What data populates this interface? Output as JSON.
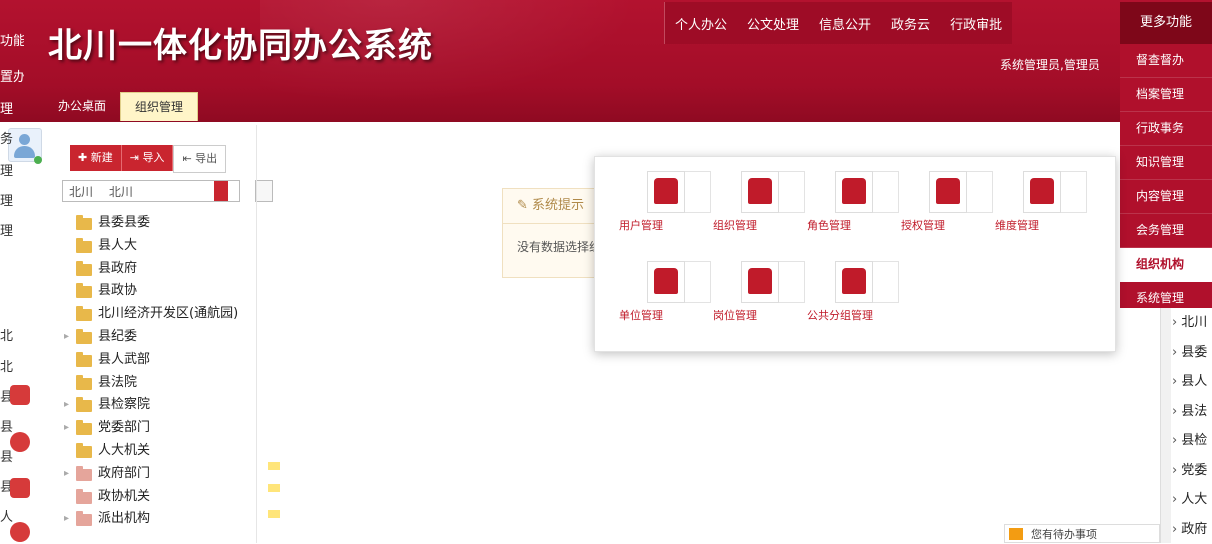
{
  "app": {
    "title": "北川一体化协同办公系统"
  },
  "top_nav": [
    "个人办公",
    "公文处理",
    "信息公开",
    "政务云",
    "行政审批"
  ],
  "more_label": "更多功能",
  "sub_nav": "系统管理员,管理员",
  "tabs": [
    {
      "label": "办公桌面"
    },
    {
      "label": "组织管理"
    }
  ],
  "left_column": {
    "items": [
      "功能",
      "置办",
      "理",
      "务",
      "理",
      "理",
      "理",
      "北",
      "北",
      "县",
      "县",
      "县",
      "县",
      "人"
    ]
  },
  "toolbar": {
    "new_label": "新建",
    "import_label": "导入",
    "export_label": "导出"
  },
  "search": {
    "prefix": "北川",
    "value": "北川"
  },
  "tree": [
    {
      "label": "县委县委",
      "arrow": "",
      "color": "yellow"
    },
    {
      "label": "县人大",
      "arrow": "",
      "color": "yellow"
    },
    {
      "label": "县政府",
      "arrow": "",
      "color": "yellow"
    },
    {
      "label": "县政协",
      "arrow": "",
      "color": "yellow"
    },
    {
      "label": "北川经济开发区(通航园)",
      "arrow": "",
      "color": "yellow"
    },
    {
      "label": "县纪委",
      "arrow": "▸",
      "color": "yellow"
    },
    {
      "label": "县人武部",
      "arrow": "",
      "color": "yellow"
    },
    {
      "label": "县法院",
      "arrow": "",
      "color": "yellow"
    },
    {
      "label": "县检察院",
      "arrow": "▸",
      "color": "yellow"
    },
    {
      "label": "党委部门",
      "arrow": "▸",
      "color": "yellow"
    },
    {
      "label": "人大机关",
      "arrow": "",
      "color": "yellow"
    },
    {
      "label": "政府部门",
      "arrow": "▸",
      "color": "pink"
    },
    {
      "label": "政协机关",
      "arrow": "",
      "color": "pink"
    },
    {
      "label": "派出机构",
      "arrow": "▸",
      "color": "pink"
    }
  ],
  "info_card": {
    "title": "系统提示",
    "body": "没有数据选择组织"
  },
  "panel_tiles": [
    {
      "label": "用户管理"
    },
    {
      "label": "组织管理"
    },
    {
      "label": "角色管理"
    },
    {
      "label": "授权管理"
    },
    {
      "label": "维度管理"
    },
    {
      "label": "单位管理"
    },
    {
      "label": "岗位管理"
    },
    {
      "label": "公共分组管理"
    }
  ],
  "dropdown_menu": [
    "督查督办",
    "档案管理",
    "行政事务",
    "知识管理",
    "内容管理",
    "会务管理",
    "组织机构",
    "系统管理"
  ],
  "dropdown_highlight_index": 6,
  "right_tree": [
    "北川",
    "县委",
    "县人",
    "县法",
    "县检",
    "党委",
    "人大",
    "政府"
  ],
  "status_bar": "您有待办事项"
}
